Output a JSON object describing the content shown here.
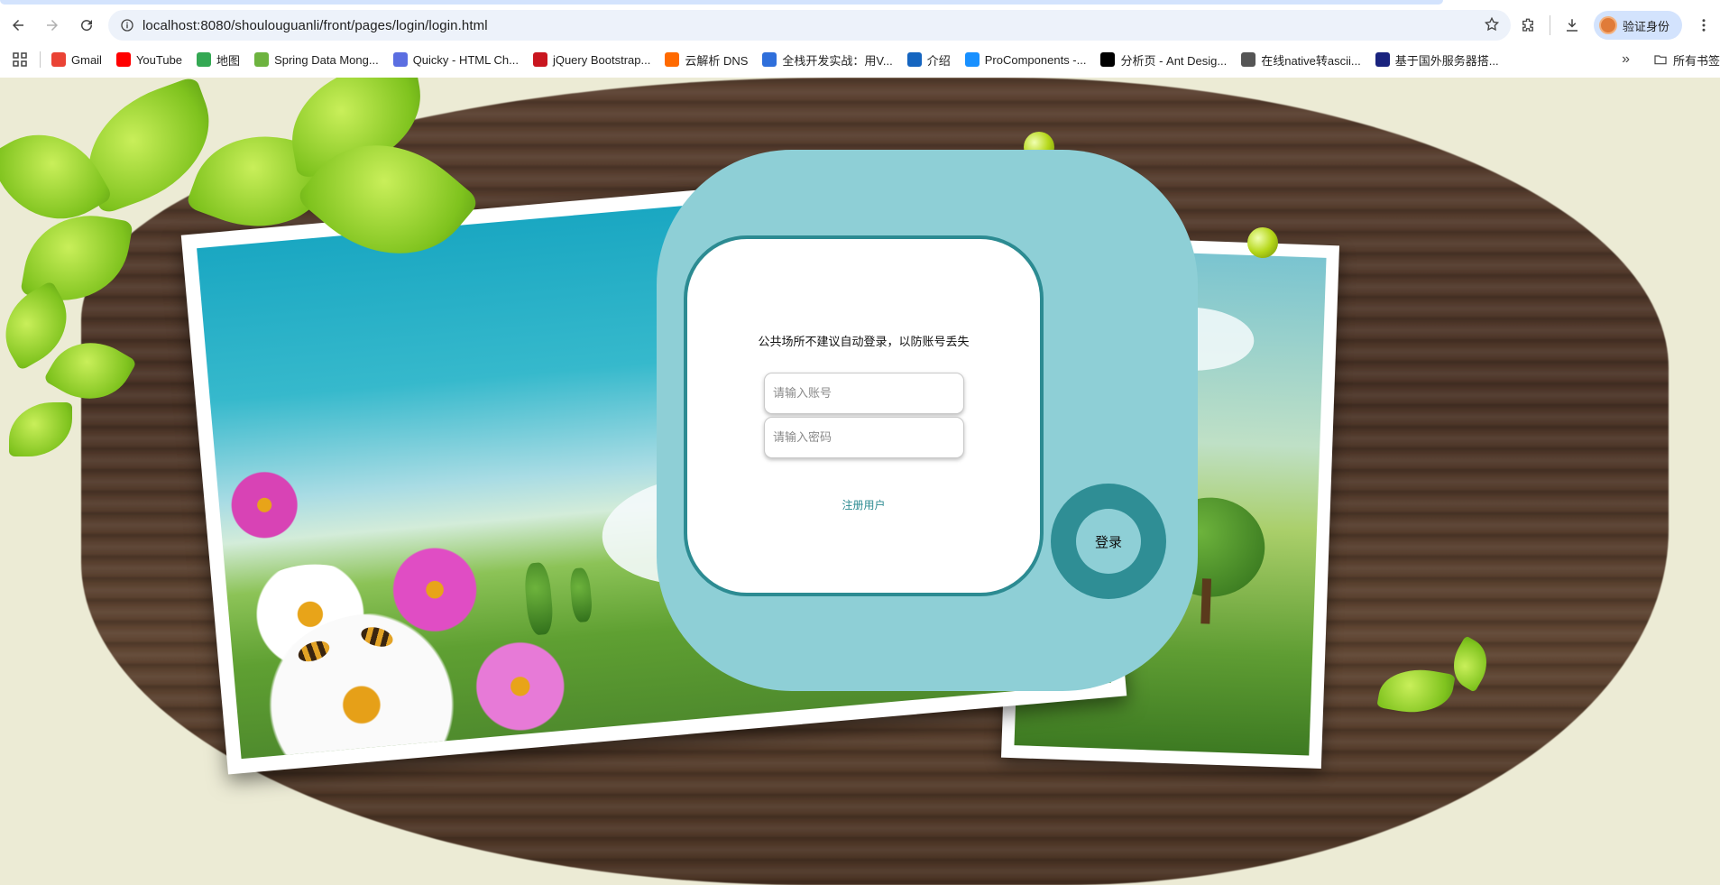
{
  "browser": {
    "url": "localhost:8080/shoulouguanli/front/pages/login/login.html",
    "profile_label": "验证身份",
    "bookmarks": [
      {
        "label": "Gmail",
        "icon": "gmail-icon",
        "color": "#ea4335"
      },
      {
        "label": "YouTube",
        "icon": "youtube-icon",
        "color": "#ff0000"
      },
      {
        "label": "地图",
        "icon": "maps-pin-icon",
        "color": "#34a853"
      },
      {
        "label": "Spring Data Mong...",
        "icon": "spring-leaf-icon",
        "color": "#6db33f"
      },
      {
        "label": "Quicky - HTML Ch...",
        "icon": "quicky-icon",
        "color": "#5b6ee1"
      },
      {
        "label": "jQuery Bootstrap...",
        "icon": "jquery-icon",
        "color": "#c9161f"
      },
      {
        "label": "云解析 DNS",
        "icon": "aliyun-icon",
        "color": "#ff6a00"
      },
      {
        "label": "全栈开发实战：用V...",
        "icon": "m-icon",
        "color": "#2f6fdb"
      },
      {
        "label": "介绍",
        "icon": "globe-half-icon",
        "color": "#1565c0"
      },
      {
        "label": "ProComponents -...",
        "icon": "diamond-icon",
        "color": "#1890ff"
      },
      {
        "label": "分析页 - Ant Desig...",
        "icon": "pro-icon",
        "color": "#000000"
      },
      {
        "label": "在线native转ascii...",
        "icon": "globe-icon",
        "color": "#555555"
      },
      {
        "label": "基于国外服务器搭...",
        "icon": "ring-icon",
        "color": "#1a237e"
      }
    ],
    "all_bookmarks_label": "所有书签"
  },
  "login": {
    "notice": "公共场所不建议自动登录，以防账号丢失",
    "username_placeholder": "请输入账号",
    "password_placeholder": "请输入密码",
    "register_label": "注册用户",
    "login_button_label": "登录"
  },
  "colors": {
    "outer_card": "#8ecfd6",
    "border_teal": "#2c8b92",
    "login_ring": "#2f8e95"
  }
}
